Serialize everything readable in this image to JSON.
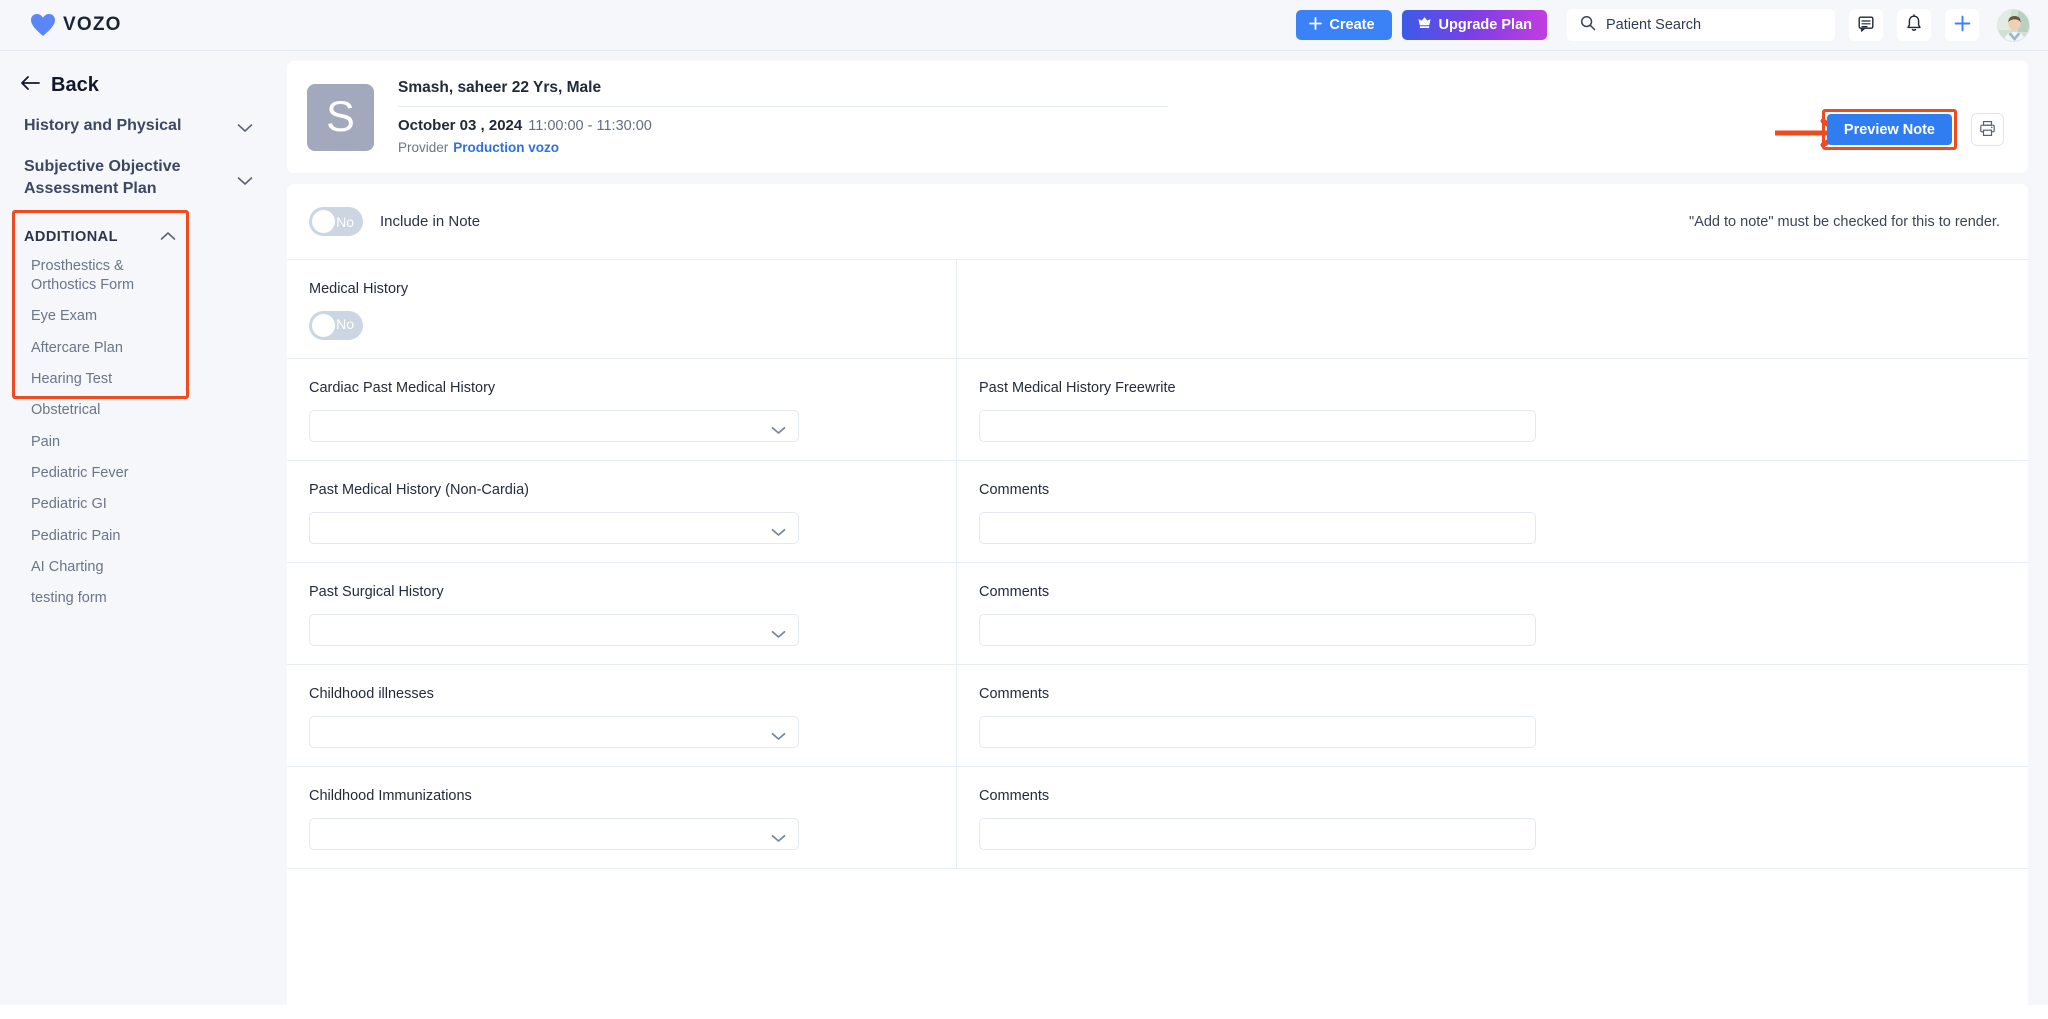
{
  "app": {
    "brand": "VOZO",
    "brand_icon": "heart-icon"
  },
  "topbar": {
    "create_label": "Create",
    "create_icon": "plus-icon",
    "create_color": "#3b82f6",
    "upgrade_label": "Upgrade Plan",
    "upgrade_icon": "crown-icon",
    "upgrade_gradient_from": "#3b5ce8",
    "upgrade_gradient_to": "#c13de0",
    "search_placeholder": "Patient Search",
    "search_value": "",
    "search_icon": "search-icon",
    "icons": [
      "message-icon",
      "bell-icon",
      "plus-icon"
    ],
    "avatar": "user-avatar"
  },
  "sidebar": {
    "back_label": "Back",
    "back_icon": "arrow-left-icon",
    "sections": [
      {
        "label": "History and Physical",
        "chevron": "chevron-down-icon",
        "expanded": false
      },
      {
        "label": "Subjective Objective Assessment Plan",
        "chevron": "chevron-down-icon",
        "expanded": false
      }
    ],
    "additional": {
      "title": "ADDITIONAL",
      "chevron": "chevron-up-icon",
      "expanded": true,
      "highlight_color": "#f04a21",
      "items": [
        "Prosthestics & Orthostics Form",
        "Eye Exam",
        "Aftercare Plan",
        "Hearing Test",
        "Obstetrical",
        "Pain",
        "Pediatric Fever",
        "Pediatric GI",
        "Pediatric Pain",
        "AI Charting",
        "testing form"
      ]
    }
  },
  "patient_card": {
    "avatar_initial": "S",
    "name_line": "Smash, saheer 22 Yrs, Male",
    "date": "October 03 , 2024",
    "time_range": "11:00:00 - 11:30:00",
    "provider_label": "Provider",
    "provider_name": "Production vozo",
    "preview_button": "Preview Note",
    "preview_button_color": "#2f7df0",
    "preview_highlight_color": "#f04a21",
    "print_icon": "printer-icon",
    "annotation_arrow": "arrow-right-annotation"
  },
  "form": {
    "include_toggle": {
      "value": "No",
      "label": "Include in Note",
      "state": "off"
    },
    "hint": "\"Add to note\" must be checked for this to render.",
    "medical_history": {
      "label": "Medical History",
      "toggle_value": "No",
      "state": "off"
    },
    "rows": [
      {
        "left_label": "Cardiac Past Medical History",
        "left_type": "select",
        "left_value": "",
        "right_label": "Past Medical History Freewrite",
        "right_type": "text",
        "right_value": ""
      },
      {
        "left_label": "Past Medical History (Non-Cardia)",
        "left_type": "select",
        "left_value": "",
        "right_label": "Comments",
        "right_type": "text",
        "right_value": ""
      },
      {
        "left_label": "Past Surgical History",
        "left_type": "select",
        "left_value": "",
        "right_label": "Comments",
        "right_type": "text",
        "right_value": ""
      },
      {
        "left_label": "Childhood illnesses",
        "left_type": "select",
        "left_value": "",
        "right_label": "Comments",
        "right_type": "text",
        "right_value": ""
      },
      {
        "left_label": "Childhood Immunizations",
        "left_type": "select",
        "left_value": "",
        "right_label": "Comments",
        "right_type": "text",
        "right_value": ""
      }
    ]
  }
}
